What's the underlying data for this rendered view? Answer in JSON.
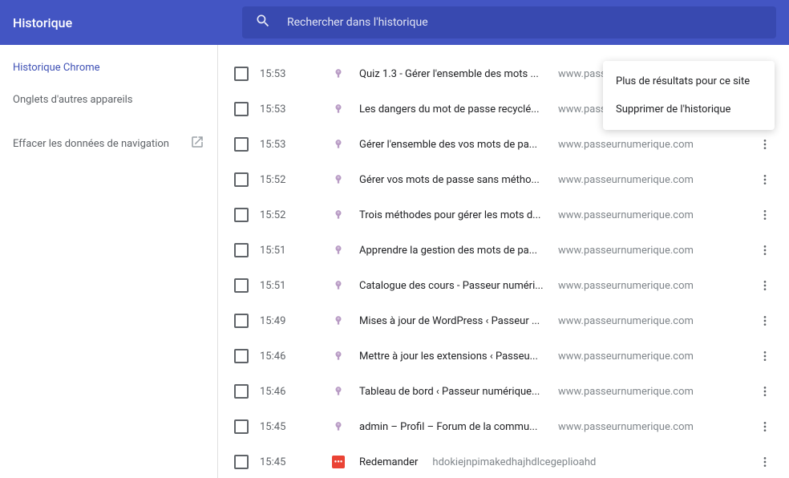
{
  "header": {
    "title": "Historique",
    "search_placeholder": "Rechercher dans l'historique"
  },
  "sidebar": {
    "items": [
      {
        "label": "Historique Chrome",
        "active": true,
        "icon": null
      },
      {
        "label": "Onglets d'autres appareils",
        "active": false,
        "icon": null
      },
      {
        "label": "Effacer les données de navigation",
        "active": false,
        "icon": "open-external"
      }
    ]
  },
  "history": [
    {
      "time": "15:53",
      "title": "Quiz 1.3 - Gérer l'ensemble des mots ...",
      "domain": "www.passeurnumerique.com",
      "icon": "default"
    },
    {
      "time": "15:53",
      "title": "Les dangers du mot de passe recyclé...",
      "domain": "www.passeurnumerique.com",
      "icon": "default"
    },
    {
      "time": "15:53",
      "title": "Gérer l'ensemble des vos mots de pa...",
      "domain": "www.passeurnumerique.com",
      "icon": "default"
    },
    {
      "time": "15:52",
      "title": "Gérer vos mots de passe sans métho...",
      "domain": "www.passeurnumerique.com",
      "icon": "default"
    },
    {
      "time": "15:52",
      "title": "Trois méthodes pour gérer les mots d...",
      "domain": "www.passeurnumerique.com",
      "icon": "default"
    },
    {
      "time": "15:51",
      "title": "Apprendre la gestion des mots de pa...",
      "domain": "www.passeurnumerique.com",
      "icon": "default"
    },
    {
      "time": "15:51",
      "title": "Catalogue des cours - Passeur numéri...",
      "domain": "www.passeurnumerique.com",
      "icon": "default"
    },
    {
      "time": "15:49",
      "title": "Mises à jour de WordPress ‹ Passeur ...",
      "domain": "www.passeurnumerique.com",
      "icon": "default"
    },
    {
      "time": "15:46",
      "title": "Mettre à jour les extensions ‹ Passeu...",
      "domain": "www.passeurnumerique.com",
      "icon": "default"
    },
    {
      "time": "15:46",
      "title": "Tableau de bord ‹ Passeur numérique...",
      "domain": "www.passeurnumerique.com",
      "icon": "default"
    },
    {
      "time": "15:45",
      "title": "admin – Profil – Forum de la commu...",
      "domain": "www.passeurnumerique.com",
      "icon": "default"
    },
    {
      "time": "15:45",
      "title": "Redemander",
      "domain": "hdokiejnpimakedhajhdlcegeplioahd",
      "icon": "red",
      "inline_domain": true
    }
  ],
  "context_menu": {
    "items": [
      "Plus de résultats pour ce site",
      "Supprimer de l'historique"
    ]
  }
}
